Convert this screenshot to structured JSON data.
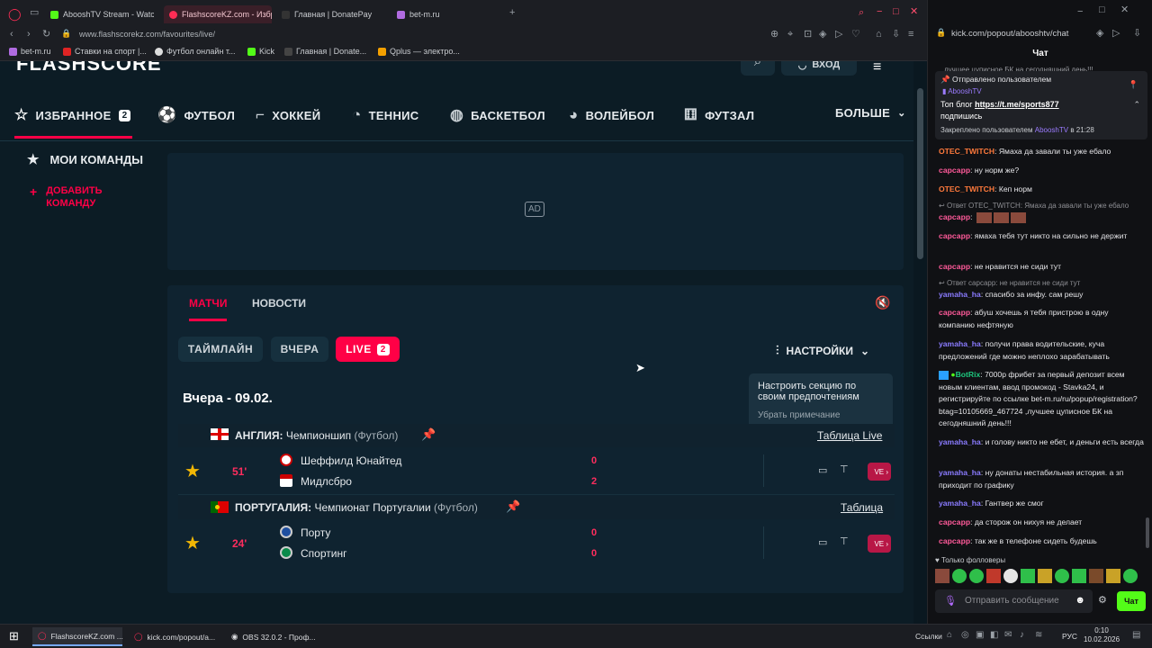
{
  "browser": {
    "tabs": [
      {
        "label": "AbooshTV Stream - Watch",
        "color": "#53fc18"
      },
      {
        "label": "FlashscoreKZ.com - Избр",
        "color": "#ff2d55",
        "active": true
      },
      {
        "label": "Главная | DonatePay",
        "color": "#eaeaea"
      },
      {
        "label": "bet-m.ru",
        "color": "#b06be0"
      }
    ],
    "url": "www.flashscorekz.com/favourites/live/",
    "bookmarks": [
      "bet-m.ru",
      "Ставки на спорт |...",
      "Футбол онлайн т...",
      "Kick",
      "Главная | Donate...",
      "Qplus — электро..."
    ]
  },
  "site": {
    "logo": "FLASHSCORE",
    "header_login": "ВХОД",
    "nav": [
      {
        "label": "ИЗБРАННОЕ",
        "badge": "2",
        "icon": "star-icon"
      },
      {
        "label": "ФУТБОЛ",
        "icon": "soccer-ball-icon"
      },
      {
        "label": "ХОККЕЙ",
        "icon": "hockey-stick-icon"
      },
      {
        "label": "ТЕННИС",
        "icon": "tennis-racket-icon"
      },
      {
        "label": "БАСКЕТБОЛ",
        "icon": "basketball-icon"
      },
      {
        "label": "ВОЛЕЙБОЛ",
        "icon": "volleyball-icon"
      },
      {
        "label": "ФУТЗАЛ",
        "icon": "futsal-icon"
      }
    ],
    "nav_more": "БОЛЬШЕ",
    "sidebar": {
      "my_teams": "МОИ КОМАНДЫ",
      "add_team": "ДОБАВИТЬ КОМАНДУ"
    },
    "ad_label": "AD",
    "content_tabs": [
      "МАТЧИ",
      "НОВОСТИ"
    ],
    "filters": {
      "timeline": "ТАЙМЛАЙН",
      "yesterday": "ВЧЕРА",
      "live": "LIVE",
      "live_count": "2"
    },
    "settings_label": "НАСТРОЙКИ",
    "tooltip": {
      "text": "Настроить секцию по своим предпочтениям",
      "dismiss": "Убрать примечание"
    },
    "date_heading": "Вчера - 09.02.",
    "leagues": [
      {
        "country": "АНГЛИЯ:",
        "name": "Чемпионшип",
        "sport": "(Футбол)",
        "table_link": "Таблица Live",
        "minute": "51'",
        "home": "Шеффилд Юнайтед",
        "away": "Мидлсбро",
        "home_score": "0",
        "away_score": "2",
        "live_tag": "VE"
      },
      {
        "country": "ПОРТУГАЛИЯ:",
        "name": "Чемпионат Португалии",
        "sport": "(Футбол)",
        "table_link": "Таблица",
        "minute": "24'",
        "home": "Порту",
        "away": "Спортинг",
        "home_score": "0",
        "away_score": "0",
        "live_tag": "VE"
      }
    ]
  },
  "chat": {
    "url": "kick.com/popout/abooshtv/chat",
    "title": "Чат",
    "pinned": {
      "header": "Отправлено пользователем",
      "author": "AbooshTV",
      "text_prefix": "Топ блог ",
      "link": "https://t.me/sports877",
      "text_suffix": "подпишись",
      "footer_prefix": "Закреплено пользователем",
      "footer_user": "AbooshTV",
      "footer_time": "в 21:28",
      "cut_line": "лучшее цуписное БК на сегодняшний день!!!"
    },
    "messages": [
      {
        "user": "OTEC_TWITCH",
        "text": ": Ямаха да завали ты уже ебало"
      },
      {
        "user": "сарсарр",
        "text": ": ну норм же?"
      },
      {
        "user": "OTEC_TWITCH",
        "text": ": Кеп норм"
      },
      {
        "reply": "Ответ OTEC_TWITCH: Ямаха да завали ты уже ебало",
        "user": "сарсарр",
        "text": ":"
      },
      {
        "user": "сарсарр",
        "text": ": ямаха тебя тут никто на сильно не держит"
      },
      {
        "user": "сарсарр",
        "text": ": не нравится не сиди тут"
      },
      {
        "reply": "Ответ сарсарр: не нравится не сиди тут",
        "user": "yamaha_ha",
        "text": ": спасибо за инфу. сам решу"
      },
      {
        "user": "сарсарр",
        "text": ": абуш хочешь я тебя пристрою в одну компанию нефтяную"
      },
      {
        "user": "yamaha_ha",
        "text": ": получи права водительские, куча предложений где можно неплохо зарабатывать"
      },
      {
        "user": "BotRix",
        "text": ": 7000р фрибет за первый депозит всем новым клиентам, ввод промокод - Stavka24, и регистрируйте по ссылке bet-m.ru/ru/popup/registration?btag=10105669_467724 ,лучшее цуписное БК на сегодняшний день!!!"
      },
      {
        "user": "yamaha_ha",
        "text": ": и голову никто не ебет, и деньги есть всегда"
      },
      {
        "user": "yamaha_ha",
        "text": ": ну донаты нестабильная история. а зп приходит по графику"
      },
      {
        "user": "yamaha_ha",
        "text": ": Гантвер же смог"
      },
      {
        "user": "сарсарр",
        "text": ": да сторож он нихуя не делает"
      },
      {
        "user": "сарсарр",
        "text": ": так же в телефоне сидеть будешь"
      }
    ],
    "followers_only": "Только фолловеры",
    "input_placeholder": "Отправить сообщение",
    "send_label": "Чат"
  },
  "taskbar": {
    "items": [
      "FlashscoreKZ.com ...",
      "kick.com/popout/a...",
      "OBS 32.0.2 - Проф..."
    ],
    "tray_label": "Ссылки",
    "lang": "РУС",
    "time": "0:10",
    "date": "10.02.2026"
  },
  "colors": {
    "accent": "#ff0046",
    "kick_green": "#53fc18",
    "bg": "#0c1c25"
  }
}
